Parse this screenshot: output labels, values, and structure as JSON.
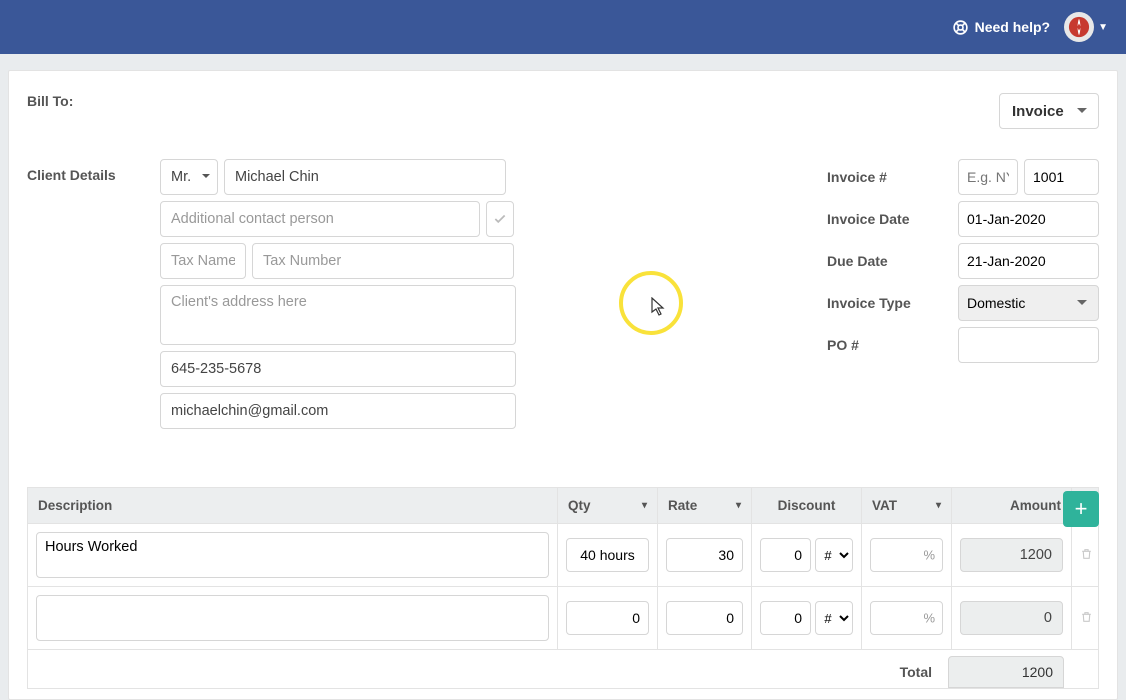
{
  "header": {
    "help_label": "Need help?"
  },
  "doc_type": {
    "selected": "Invoice"
  },
  "bill_to_label": "Bill To:",
  "client_details_label": "Client Details",
  "client": {
    "title_selected": "Mr.",
    "name": "Michael Chin",
    "additional_contact_placeholder": "Additional contact person",
    "tax_name_placeholder": "Tax Name",
    "tax_number_placeholder": "Tax Number",
    "address_placeholder": "Client's address here",
    "phone": "645-235-5678",
    "email": "michaelchin@gmail.com"
  },
  "invoice_meta": {
    "labels": {
      "number": "Invoice #",
      "date": "Invoice Date",
      "due": "Due Date",
      "type": "Invoice Type",
      "po": "PO #"
    },
    "number_prefix_placeholder": "E.g. NYC",
    "number_value": "1001",
    "date": "01-Jan-2020",
    "due": "21-Jan-2020",
    "type_selected": "Domestic",
    "po_value": ""
  },
  "table": {
    "headers": {
      "desc": "Description",
      "qty": "Qty",
      "rate": "Rate",
      "disc": "Discount",
      "vat": "VAT",
      "amt": "Amount"
    },
    "rows": [
      {
        "desc": "Hours Worked",
        "qty": "40 hours",
        "rate": "30",
        "discount": "0",
        "discount_type": "#",
        "vat": "",
        "amount": "1200"
      },
      {
        "desc": "",
        "qty": "0",
        "rate": "0",
        "discount": "0",
        "discount_type": "#",
        "vat": "",
        "amount": "0"
      }
    ],
    "total_label": "Total",
    "total_value": "1200"
  }
}
